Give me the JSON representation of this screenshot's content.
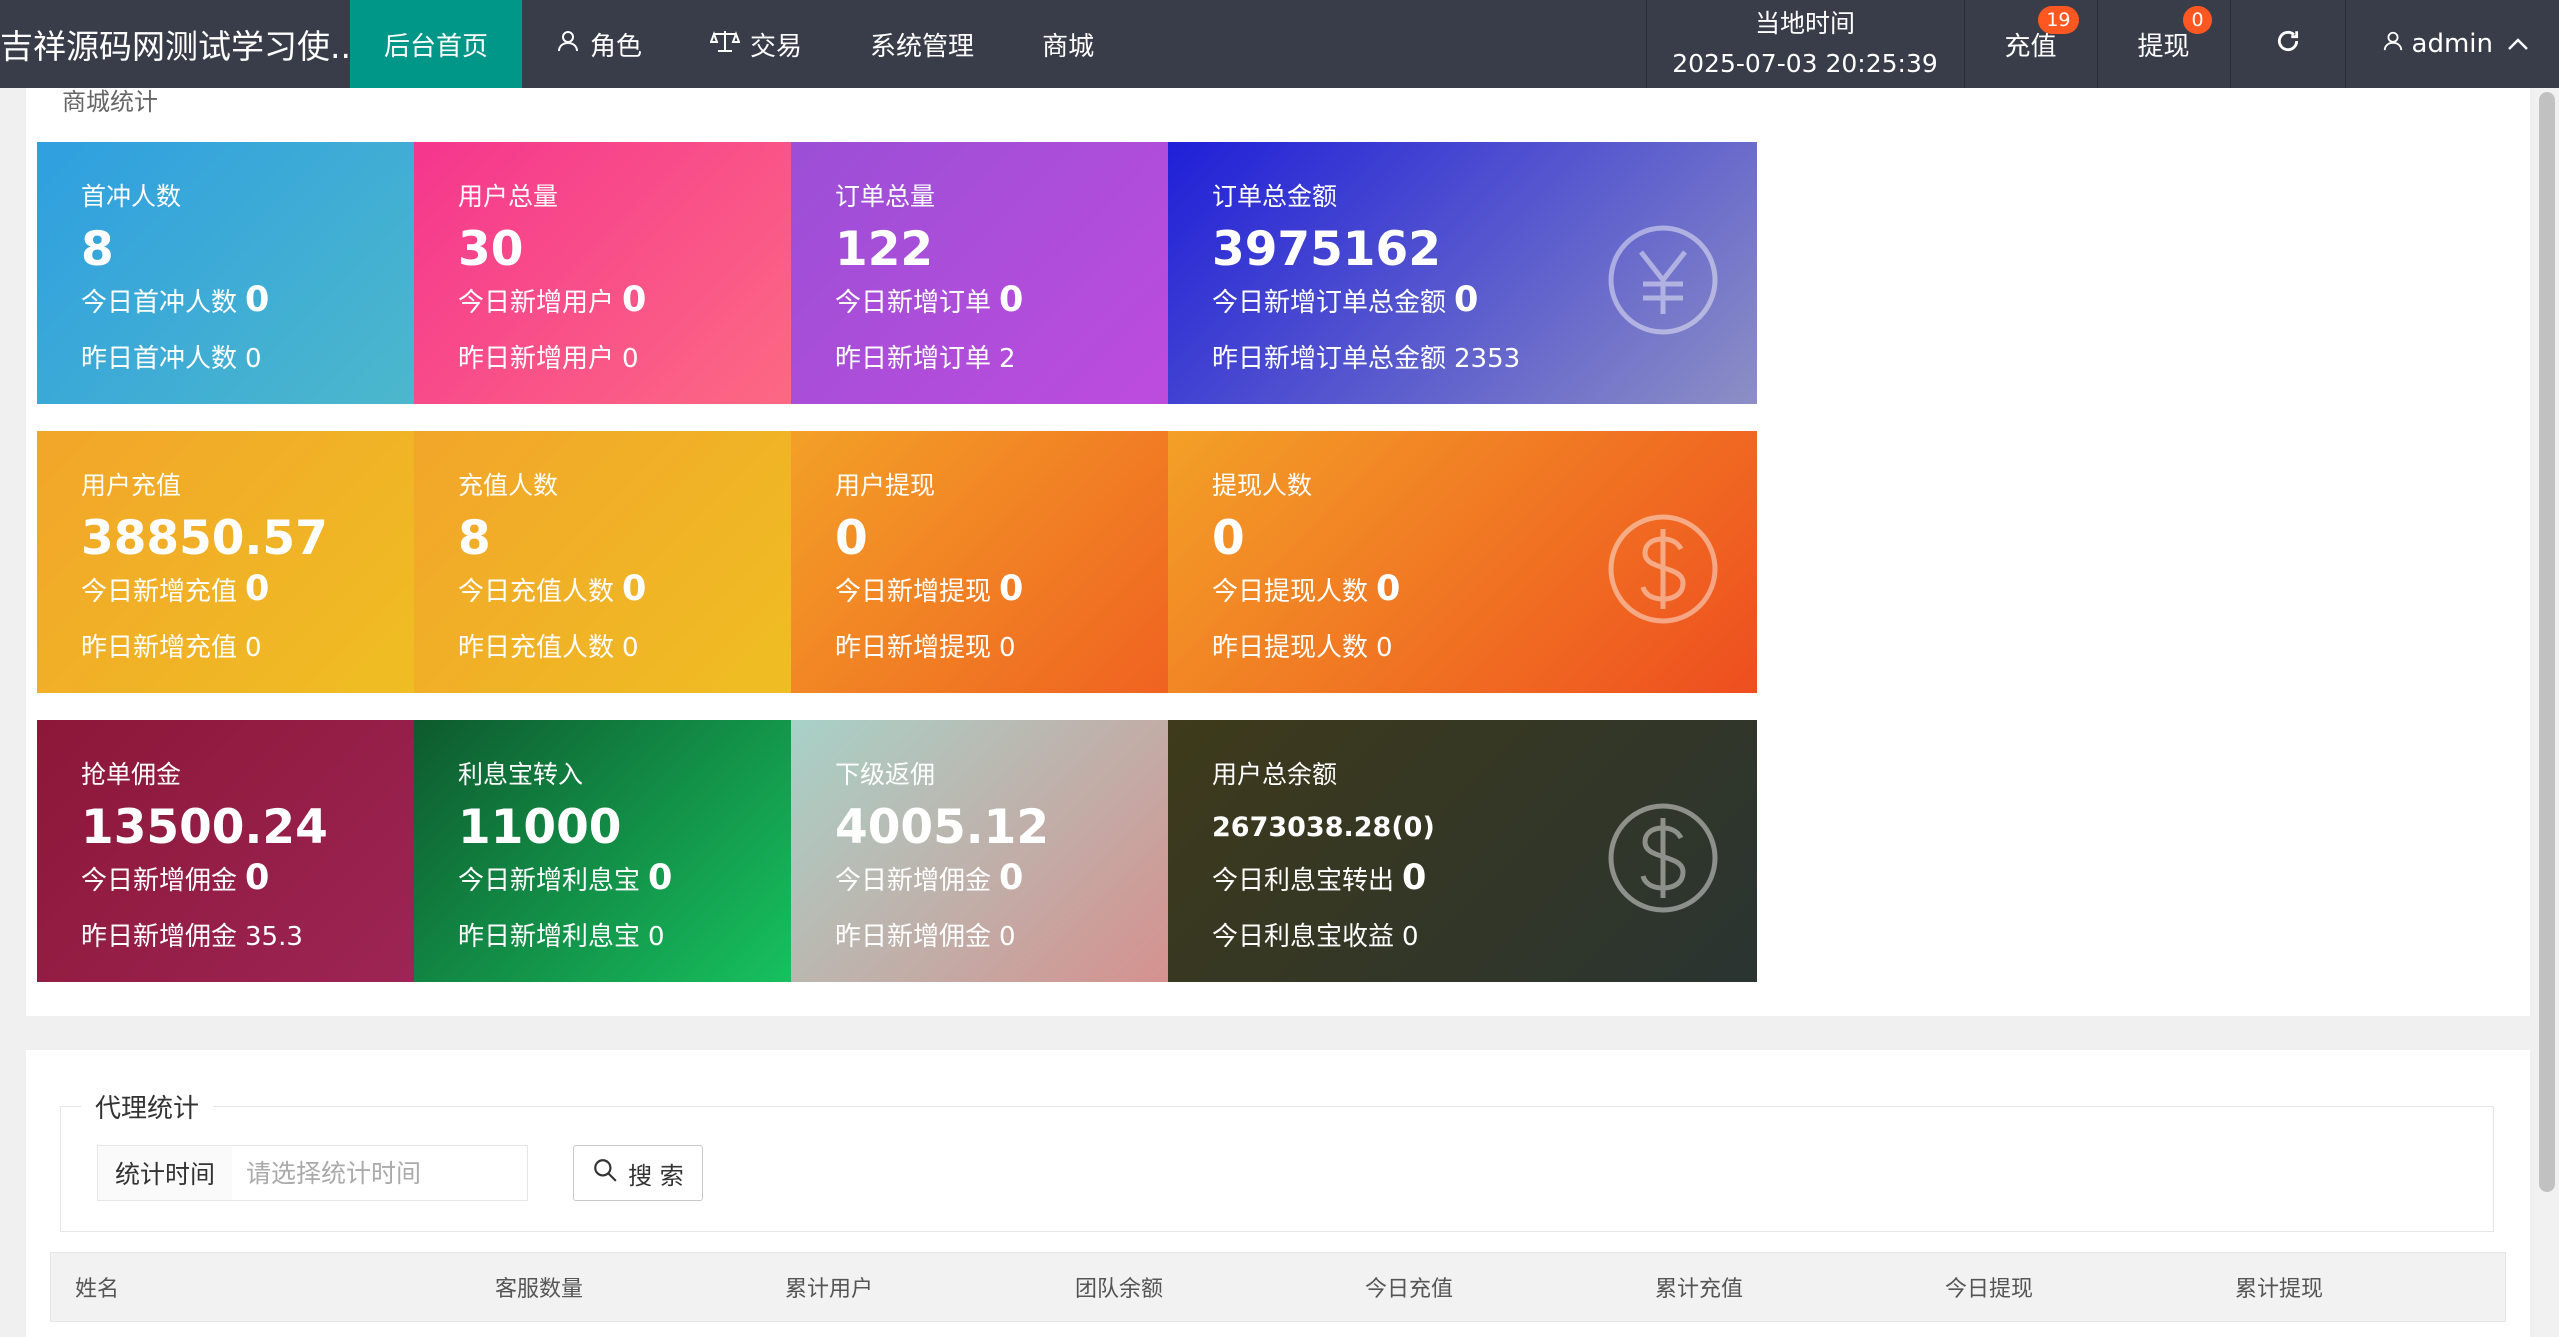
{
  "header": {
    "brand": "吉祥源码网测试学习使...",
    "nav": [
      {
        "label": "后台首页",
        "icon": "",
        "active": true
      },
      {
        "label": "角色",
        "icon": "user-icon"
      },
      {
        "label": "交易",
        "icon": "scale-icon"
      },
      {
        "label": "系统管理",
        "icon": ""
      },
      {
        "label": "商城",
        "icon": ""
      }
    ],
    "time_label": "当地时间",
    "time_value": "2025-07-03 20:25:39",
    "recharge_label": "充值",
    "recharge_badge": "19",
    "withdraw_label": "提现",
    "withdraw_badge": "0",
    "refresh_icon": "refresh-icon",
    "user_label": "admin"
  },
  "mall": {
    "legend": "商城统计",
    "cards": [
      {
        "title": "首冲人数",
        "value": "8",
        "today_label": "今日首冲人数",
        "today_value": "0",
        "yest_label": "昨日首冲人数",
        "yest_value": "0",
        "icon": "layers-icon",
        "gradient": [
          "#2f9fe0",
          "#56c0c5"
        ]
      },
      {
        "title": "用户总量",
        "value": "30",
        "today_label": "今日新增用户",
        "today_value": "0",
        "yest_label": "昨日新增用户",
        "yest_value": "0",
        "icon": "users-icon",
        "gradient": [
          "#f5368e",
          "#ff7a80"
        ]
      },
      {
        "title": "订单总量",
        "value": "122",
        "today_label": "今日新增订单",
        "today_value": "0",
        "yest_label": "昨日新增订单",
        "yest_value": "2",
        "icon": "book-icon",
        "gradient": [
          "#9b4fd6",
          "#c94be0"
        ]
      },
      {
        "title": "订单总金额",
        "value": "3975162",
        "today_label": "今日新增订单总金额",
        "today_value": "0",
        "yest_label": "昨日新增订单总金额",
        "yest_value": "2353",
        "icon": "yen-icon",
        "gradient": [
          "#1f1fd8",
          "#8d8fc5"
        ]
      },
      {
        "title": "用户充值",
        "value": "38850.57",
        "today_label": "今日新增充值",
        "today_value": "0",
        "yest_label": "昨日新增充值",
        "yest_value": "0",
        "icon": "question-edit-icon",
        "gradient": [
          "#f2a52a",
          "#eec620"
        ]
      },
      {
        "title": "充值人数",
        "value": "8",
        "today_label": "今日充值人数",
        "today_value": "0",
        "yest_label": "昨日充值人数",
        "yest_value": "0",
        "icon": "question-edit-icon",
        "gradient": [
          "#f2a52a",
          "#eec620"
        ]
      },
      {
        "title": "用户提现",
        "value": "0",
        "today_label": "今日新增提现",
        "today_value": "0",
        "yest_label": "昨日新增提现",
        "yest_value": "0",
        "icon": "dollar-icon",
        "gradient": [
          "#f3a027",
          "#ee4e1f"
        ]
      },
      {
        "title": "提现人数",
        "value": "0",
        "today_label": "今日提现人数",
        "today_value": "0",
        "yest_label": "昨日提现人数",
        "yest_value": "0",
        "icon": "dollar-icon",
        "gradient": [
          "#f3a027",
          "#ee4e1f"
        ]
      },
      {
        "title": "抢单佣金",
        "value": "13500.24",
        "today_label": "今日新增佣金",
        "today_value": "0",
        "yest_label": "昨日新增佣金",
        "yest_value": "35.3",
        "icon": "question-edit-icon",
        "gradient": [
          "#8c1738",
          "#a3295e"
        ]
      },
      {
        "title": "利息宝转入",
        "value": "11000",
        "today_label": "今日新增利息宝",
        "today_value": "0",
        "yest_label": "昨日新增利息宝",
        "yest_value": "0",
        "icon": "dollar-icon",
        "gradient": [
          "#0e5a2e",
          "#19e36f"
        ]
      },
      {
        "title": "下级返佣",
        "value": "4005.12",
        "today_label": "今日新增佣金",
        "today_value": "0",
        "yest_label": "昨日新增佣金",
        "yest_value": "0",
        "icon": "question-edit-icon",
        "gradient": [
          "#a8d2c8",
          "#e47c7c"
        ]
      },
      {
        "title": "用户总余额",
        "value": "2673038.28(0)",
        "today_label": "今日利息宝转出",
        "today_value": "0",
        "yest_label": "今日利息宝收益",
        "yest_value": "0",
        "icon": "dollar-icon",
        "gradient": [
          "#3e3a1b",
          "#2a3431"
        ],
        "small_value": true
      }
    ]
  },
  "agent": {
    "legend": "代理统计",
    "filter_label": "统计时间",
    "filter_placeholder": "请选择统计时间",
    "search_label": "搜 索",
    "columns": [
      "姓名",
      "客服数量",
      "累计用户",
      "团队余额",
      "今日充值",
      "累计充值",
      "今日提现",
      "累计提现"
    ]
  }
}
